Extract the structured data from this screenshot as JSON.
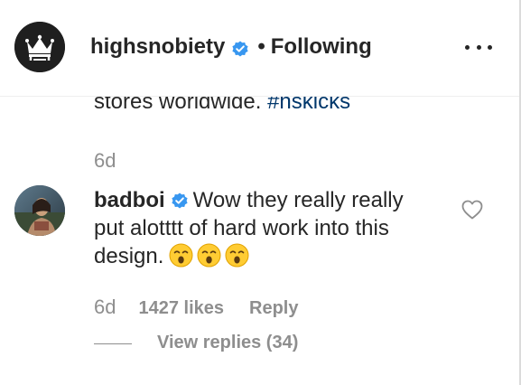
{
  "post": {
    "author": {
      "username": "highsnobiety",
      "avatar_icon": "highsnobiety-crown-logo-icon",
      "verified_icon": "verified-badge-icon"
    },
    "separator": "•",
    "follow_status": "Following",
    "more_icon": "more-options-icon",
    "caption": {
      "text_prefix": "stores worldwide. ",
      "hashtag": "#hskicks",
      "time": "6d"
    }
  },
  "comment": {
    "username": "badboi",
    "verified_icon": "verified-badge-icon",
    "text": "Wow they really really put alotttt of hard work into this design.",
    "emojis": [
      "astonished-face-emoji",
      "astonished-face-emoji",
      "astonished-face-emoji"
    ],
    "like_icon": "heart-outline-icon",
    "time": "6d",
    "likes": "1427 likes",
    "reply_label": "Reply",
    "view_replies": "View replies (34)"
  },
  "colors": {
    "primary_text": "#262626",
    "secondary_text": "#8e8e8e",
    "verified_blue": "#3897f0",
    "hashtag": "#00376b",
    "divider": "#efefef"
  }
}
